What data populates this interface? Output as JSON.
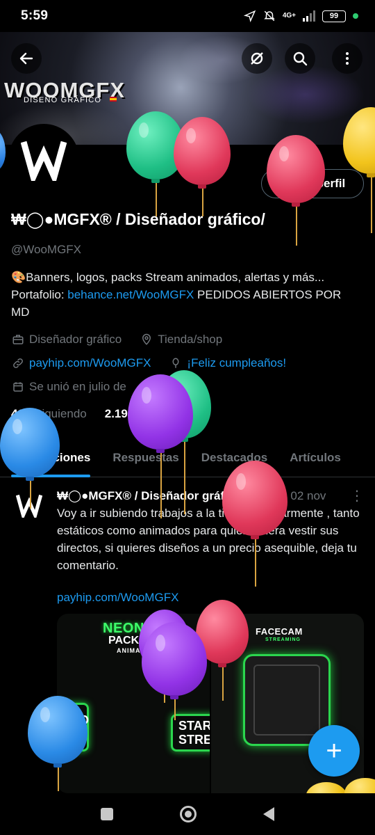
{
  "status_bar": {
    "time": "5:59",
    "network": "4G+",
    "battery": "99"
  },
  "banner": {
    "logo_text": "WOOMGFX",
    "subtitle": "DISEÑO GRÁFICO"
  },
  "profile": {
    "edit_button": "Editar perfil",
    "display_name": "₩◯●MGFX® / Diseñador gráfico/",
    "handle": "@WooMGFX",
    "bio_part1": "🎨Banners, logos, packs Stream animados, alertas y más... Portafolio: ",
    "bio_link": "behance.net/WooMGFX",
    "bio_part2": " PEDIDOS ABIERTOS POR MD",
    "category": "Diseñador gráfico",
    "location": "Tienda/shop",
    "website": "payhip.com/WooMGFX",
    "birthday": "¡Feliz cumpleaños!",
    "joined": "Se unió en julio de",
    "following_count": "466",
    "following_label": "Siguiendo",
    "followers_count": "2.194",
    "followers_label": "Seguidores"
  },
  "tabs": [
    {
      "label": "Publicaciones",
      "active": true
    },
    {
      "label": "Respuestas",
      "active": false
    },
    {
      "label": "Destacados",
      "active": false
    },
    {
      "label": "Artículos",
      "active": false
    }
  ],
  "tweet": {
    "author": "₩◯●MGFX® / Diseñador gráfico/",
    "date": "· 02 nov",
    "text": "Voy a ir subiendo trabajos a la tienda regularmente , tanto estáticos como animados para quien quiera vestir sus directos, si quieres diseños a un precio asequible, deja tu comentario.",
    "link": "payhip.com/WooMGFX",
    "media_left": {
      "title": "NEON",
      "sub1": "PACK",
      "sub2": "ANIMADO",
      "box1": "NDO AM",
      "box2": "STAR STRE"
    },
    "media_right": {
      "title": "FACECAM",
      "sub": "STREAMING"
    }
  },
  "fab": {
    "label": "+"
  },
  "colors": {
    "accent": "#1d9bf0",
    "background": "#000000",
    "muted": "#71767b",
    "neon_green": "#2bd64e"
  },
  "icons": {
    "back": "arrow-left-icon",
    "refresh": "refresh-icon",
    "search": "search-icon",
    "more": "more-vertical-icon"
  }
}
